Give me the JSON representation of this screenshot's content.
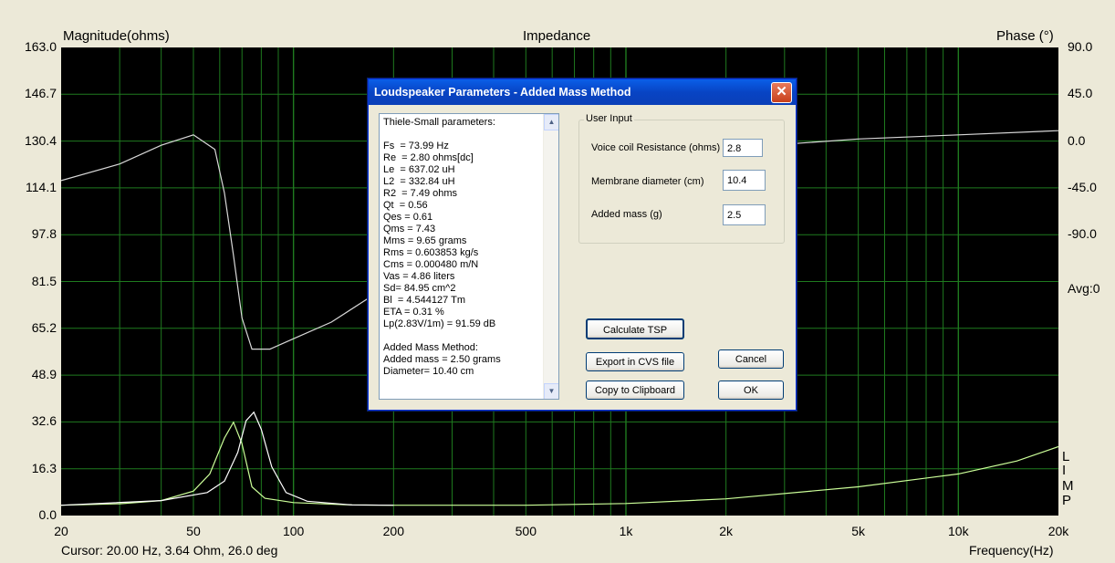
{
  "chart": {
    "title": "Impedance",
    "left_axis_label": "Magnitude(ohms)",
    "right_axis_label": "Phase (°)",
    "x_axis_label": "Frequency(Hz)",
    "status": "Cursor: 20.00 Hz, 3.64 Ohm, 26.0 deg",
    "avg_label": "Avg:0",
    "limp_letters": [
      "L",
      "I",
      "M",
      "P"
    ],
    "magnitude_ticks": [
      "163.0",
      "146.7",
      "130.4",
      "114.1",
      "97.8",
      "81.5",
      "65.2",
      "48.9",
      "32.6",
      "16.3",
      "0.0"
    ],
    "phase_ticks": [
      "90.0",
      "45.0",
      "0.0",
      "-45.0",
      "-90.0"
    ],
    "x_ticks": [
      "20",
      "50",
      "100",
      "200",
      "500",
      "1k",
      "2k",
      "5k",
      "10k",
      "20k"
    ],
    "colors": {
      "background": "#000000",
      "grid": "#1f7a1f",
      "phase_trace": "#d8d8d8",
      "magnitude_trace": "#ccff99",
      "magnitude_trace_2": "#ffffff"
    }
  },
  "chart_data": {
    "type": "line",
    "title": "Impedance",
    "xlabel": "Frequency(Hz)",
    "ylabel": "Magnitude(ohms)",
    "y2label": "Phase (°)",
    "x_scale": "log",
    "xlim": [
      20,
      20000
    ],
    "ylim": [
      0,
      163
    ],
    "y2lim": [
      -135,
      90
    ],
    "grid": true,
    "series": [
      {
        "axis": "y",
        "color": "#ccff99",
        "x": [
          20,
          30,
          40,
          50,
          56,
          62,
          66,
          70,
          75,
          82,
          100,
          150,
          200,
          500,
          1000,
          2000,
          5000,
          10000,
          15000,
          20000
        ],
        "values": [
          3.6,
          4.1,
          5.2,
          8.5,
          14.5,
          27,
          32.5,
          25,
          10,
          6,
          4.5,
          3.7,
          3.6,
          3.6,
          4.2,
          5.8,
          10,
          14.5,
          19,
          24
        ]
      },
      {
        "axis": "y",
        "color": "#ffffff",
        "x": [
          20,
          40,
          55,
          62,
          68,
          72,
          76,
          80,
          86,
          95,
          110,
          150,
          200
        ],
        "values": [
          3.6,
          5.2,
          8,
          12,
          22,
          33,
          36,
          30,
          17,
          8,
          5,
          3.7,
          3.6
        ]
      },
      {
        "axis": "y2",
        "color": "#d8d8d8",
        "x": [
          20,
          30,
          40,
          50,
          58,
          62,
          66,
          70,
          75,
          85,
          100,
          130,
          170,
          200,
          500,
          1000,
          5000,
          10000,
          20000
        ],
        "values": [
          26,
          34,
          43,
          48,
          41,
          20,
          -10,
          -40,
          -55,
          -55,
          -50,
          -42,
          -30,
          -20,
          20,
          38,
          46,
          48,
          50
        ]
      }
    ]
  },
  "dialog": {
    "title": "Loudspeaker Parameters - Added Mass Method",
    "close_glyph": "✕",
    "tsp_text": "Thiele-Small parameters:\n\nFs  = 73.99 Hz\nRe  = 2.80 ohms[dc]\nLe  = 637.02 uH\nL2  = 332.84 uH\nR2  = 7.49 ohms\nQt  = 0.56\nQes = 0.61\nQms = 7.43\nMms = 9.65 grams\nRms = 0.603853 kg/s\nCms = 0.000480 m/N\nVas = 4.86 liters\nSd= 84.95 cm^2\nBl  = 4.544127 Tm\nETA = 0.31 %\nLp(2.83V/1m) = 91.59 dB\n\nAdded Mass Method:\nAdded mass = 2.50 grams\nDiameter= 10.40 cm",
    "scroll_up": "▲",
    "scroll_down": "▼",
    "group_label": "User Input",
    "voice_coil_label": "Voice coil Resistance (ohms)",
    "voice_coil_value": "2.8",
    "membrane_label": "Membrane diameter (cm)",
    "membrane_value": "10.4",
    "added_mass_label": "Added mass (g)",
    "added_mass_value": "2.5",
    "calculate_label": "Calculate TSP",
    "export_label": "Export in CVS file",
    "cancel_label": "Cancel",
    "copy_label": "Copy to Clipboard",
    "ok_label": "OK"
  }
}
